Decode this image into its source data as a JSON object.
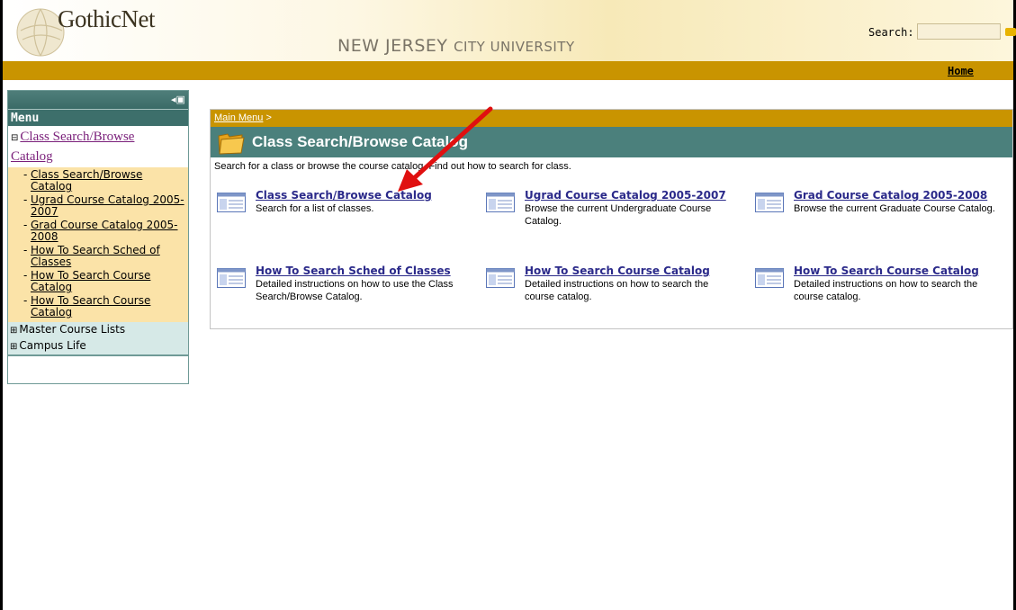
{
  "header": {
    "brand": "GothicNet",
    "university_big1": "NEW JERSEY",
    "university_small": "CITY UNIVERSITY",
    "search_label": "Search:",
    "search_value": "",
    "home_link": "Home"
  },
  "menu": {
    "title": "Menu",
    "open_section": {
      "toggle": "⊟",
      "label_line1": "Class Search/Browse",
      "label_line2": "Catalog"
    },
    "items": [
      {
        "label": "Class Search/Browse Catalog"
      },
      {
        "label": "Ugrad Course Catalog 2005-2007"
      },
      {
        "label": "Grad Course Catalog 2005-2008"
      },
      {
        "label": "How To Search Sched of Classes"
      },
      {
        "label": "How To Search Course Catalog"
      },
      {
        "label": "How To Search Course Catalog"
      }
    ],
    "closed_sections": [
      {
        "toggle": "⊞",
        "label": "Master Course Lists"
      },
      {
        "toggle": "⊞",
        "label": "Campus Life"
      }
    ]
  },
  "panel": {
    "breadcrumb": "Main Menu",
    "breadcrumb_sep": ">",
    "title": "Class Search/Browse Catalog",
    "description": "Search for a class or browse the course catalog. Find out how to search for class.",
    "links": [
      {
        "title": "Class Search/Browse Catalog",
        "desc": "Search for a list of classes."
      },
      {
        "title": "Ugrad Course Catalog 2005-2007",
        "desc": "Browse the current Undergraduate Course Catalog."
      },
      {
        "title": "Grad Course Catalog 2005-2008",
        "desc": "Browse the current Graduate Course Catalog."
      },
      {
        "title": "How To Search Sched of Classes",
        "desc": "Detailed instructions on how to use the Class Search/Browse Catalog."
      },
      {
        "title": "How To Search Course Catalog",
        "desc": "Detailed instructions on how to search the course catalog."
      },
      {
        "title": "How To Search Course Catalog",
        "desc": "Detailed instructions on how to search the course catalog."
      }
    ]
  },
  "colors": {
    "gold": "#c99400",
    "teal": "#4b807c",
    "arrow": "#e01010"
  }
}
